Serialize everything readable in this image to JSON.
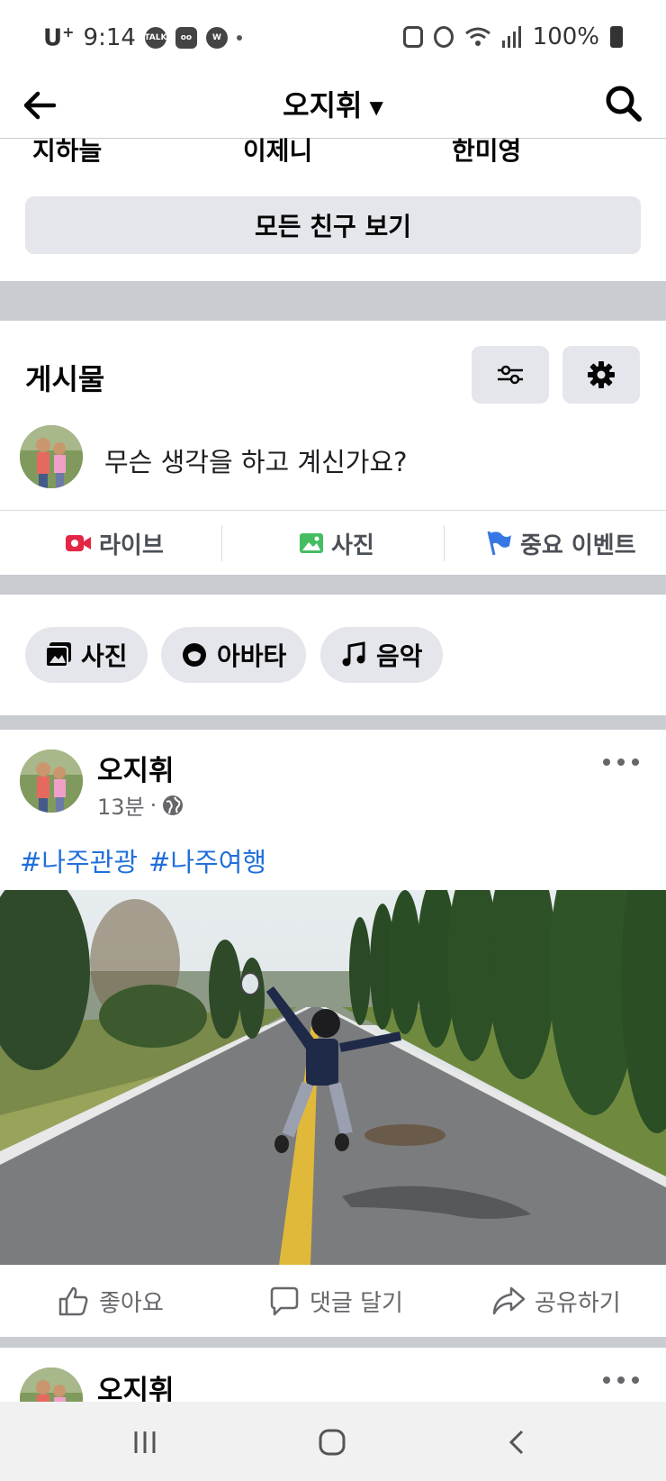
{
  "status_bar": {
    "carrier": "U",
    "carrier_sup": "+",
    "time": "9:14",
    "battery": "100%"
  },
  "header": {
    "back_icon": "arrow-left-icon",
    "title": "오지휘",
    "title_caret_icon": "caret-down-icon",
    "search_icon": "search-icon"
  },
  "friends": {
    "names": [
      "지하늘",
      "이제니",
      "한미영"
    ],
    "all_button": "모든 친구 보기"
  },
  "posts_section": {
    "title": "게시물",
    "filter_icon": "filter-sliders-icon",
    "settings_icon": "gear-icon",
    "composer_placeholder": "무슨 생각을 하고 계신가요?",
    "actions": [
      {
        "label": "라이브",
        "icon": "live-video-icon",
        "color": "#e42645"
      },
      {
        "label": "사진",
        "icon": "photo-icon",
        "color": "#45bd62"
      },
      {
        "label": "중요 이벤트",
        "icon": "flag-icon",
        "color": "#3578e5"
      }
    ],
    "chips": [
      {
        "label": "사진",
        "icon": "photos-icon"
      },
      {
        "label": "아바타",
        "icon": "avatar-icon"
      },
      {
        "label": "음악",
        "icon": "music-note-icon"
      }
    ]
  },
  "post": {
    "author": "오지휘",
    "time": "13분",
    "separator": "·",
    "privacy_icon": "globe-icon",
    "hashtags": [
      "#나주관광",
      "#나주여행"
    ],
    "photo_icon": "post-photo",
    "reactions": [
      {
        "label": "좋아요",
        "icon": "thumbs-up-icon"
      },
      {
        "label": "댓글 달기",
        "icon": "comment-icon"
      },
      {
        "label": "공유하기",
        "icon": "share-icon"
      }
    ]
  },
  "post2": {
    "author": "오지휘"
  },
  "colors": {
    "hashtag": "#216fdb",
    "chip_bg": "#e4e6eb",
    "divider": "#c9ccd1"
  }
}
